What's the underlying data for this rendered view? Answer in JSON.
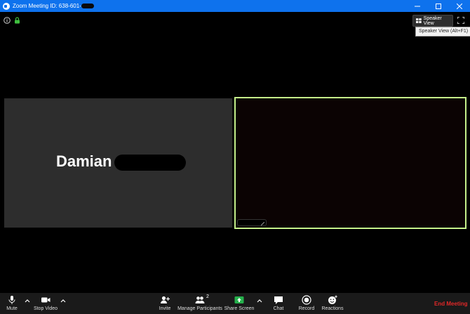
{
  "window": {
    "title": "Zoom Meeting ID: 638-601-",
    "controls": [
      "minimize",
      "maximize",
      "close"
    ]
  },
  "topbar": {
    "speaker_view_label": "Speaker View",
    "tooltip": "Speaker View (Alt+F1)"
  },
  "participants": {
    "left_name": "Damian",
    "count": "2"
  },
  "toolbar": {
    "mute": "Mute",
    "stop_video": "Stop Video",
    "invite": "Invite",
    "manage_participants": "Manage Participants",
    "share_screen": "Share Screen",
    "chat": "Chat",
    "record": "Record",
    "reactions": "Reactions",
    "end_meeting": "End Meeting"
  },
  "colors": {
    "titlebar": "#0e72ed",
    "active_speaker_border": "#c4f08a",
    "share_green": "#26b04c",
    "end_meeting_red": "#e02828",
    "lock_green": "#3fbf3f"
  }
}
